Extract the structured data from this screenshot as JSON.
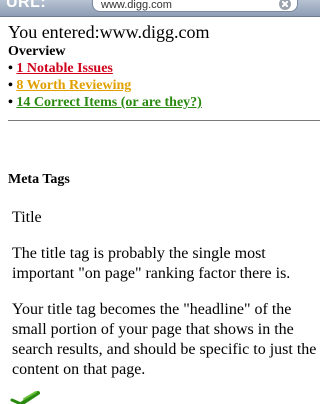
{
  "browser": {
    "url_label": "URL:",
    "url_value": "www.digg.com",
    "clear_icon": "clear-icon"
  },
  "entered": {
    "text": "You entered:www.digg.com"
  },
  "overview": {
    "title": "Overview",
    "items": [
      {
        "bullet": "•",
        "label": "1 Notable Issues",
        "color": "#d0021b"
      },
      {
        "bullet": "•",
        "label": "8 Worth Reviewing",
        "color": "#e0a000"
      },
      {
        "bullet": "•",
        "label": "14 Correct Items (or are they?)",
        "color": "#2a8a10"
      }
    ]
  },
  "meta": {
    "section_title": "Meta Tags",
    "item_title": "Title",
    "paragraphs": [
      "The title tag is probably the single most important \"on page\" ranking factor there is.",
      "Your title tag becomes the \"headline\" of the small portion of your page that shows in the search results, and should be specific to just the content on that page."
    ],
    "status_icon": "check-icon"
  }
}
